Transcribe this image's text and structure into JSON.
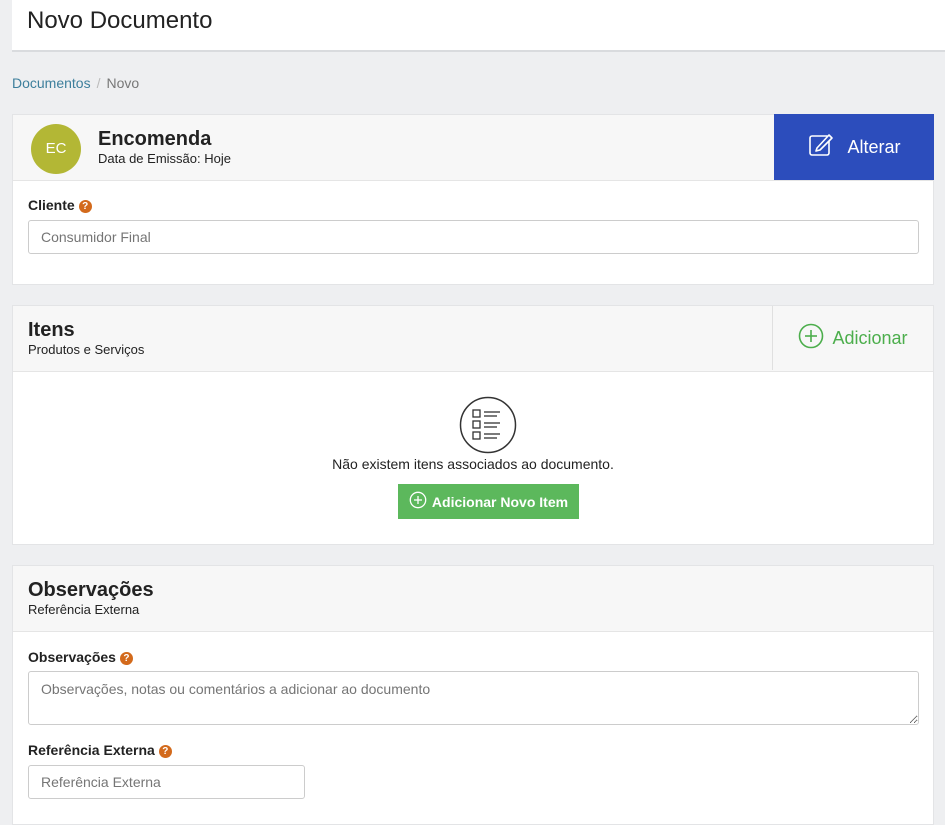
{
  "header": {
    "title": "Novo Documento"
  },
  "breadcrumb": {
    "link": "Documentos",
    "separator": "/",
    "current": "Novo"
  },
  "document": {
    "avatar": "EC",
    "type": "Encomenda",
    "date": "Data de Emissão: Hoje",
    "alterar_label": "Alterar",
    "client_label": "Cliente",
    "client_placeholder": "Consumidor Final"
  },
  "items": {
    "title": "Itens",
    "subtitle": "Produtos e Serviços",
    "add_label": "Adicionar",
    "empty_text": "Não existem itens associados ao documento.",
    "add_new_label": "Adicionar Novo Item"
  },
  "notes": {
    "title": "Observações",
    "subtitle": "Referência Externa",
    "obs_label": "Observações",
    "obs_placeholder": "Observações, notas ou comentários a adicionar ao documento",
    "ref_label": "Referência Externa",
    "ref_placeholder": "Referência Externa"
  },
  "icons": {
    "help": "question-circle",
    "alterar": "edit-icon",
    "add": "plus-circle",
    "empty": "list-icon"
  },
  "colors": {
    "accent_blue": "#2c4dbc",
    "accent_green": "#5cb85c",
    "avatar": "#b3b735",
    "help": "#d36a1c"
  }
}
